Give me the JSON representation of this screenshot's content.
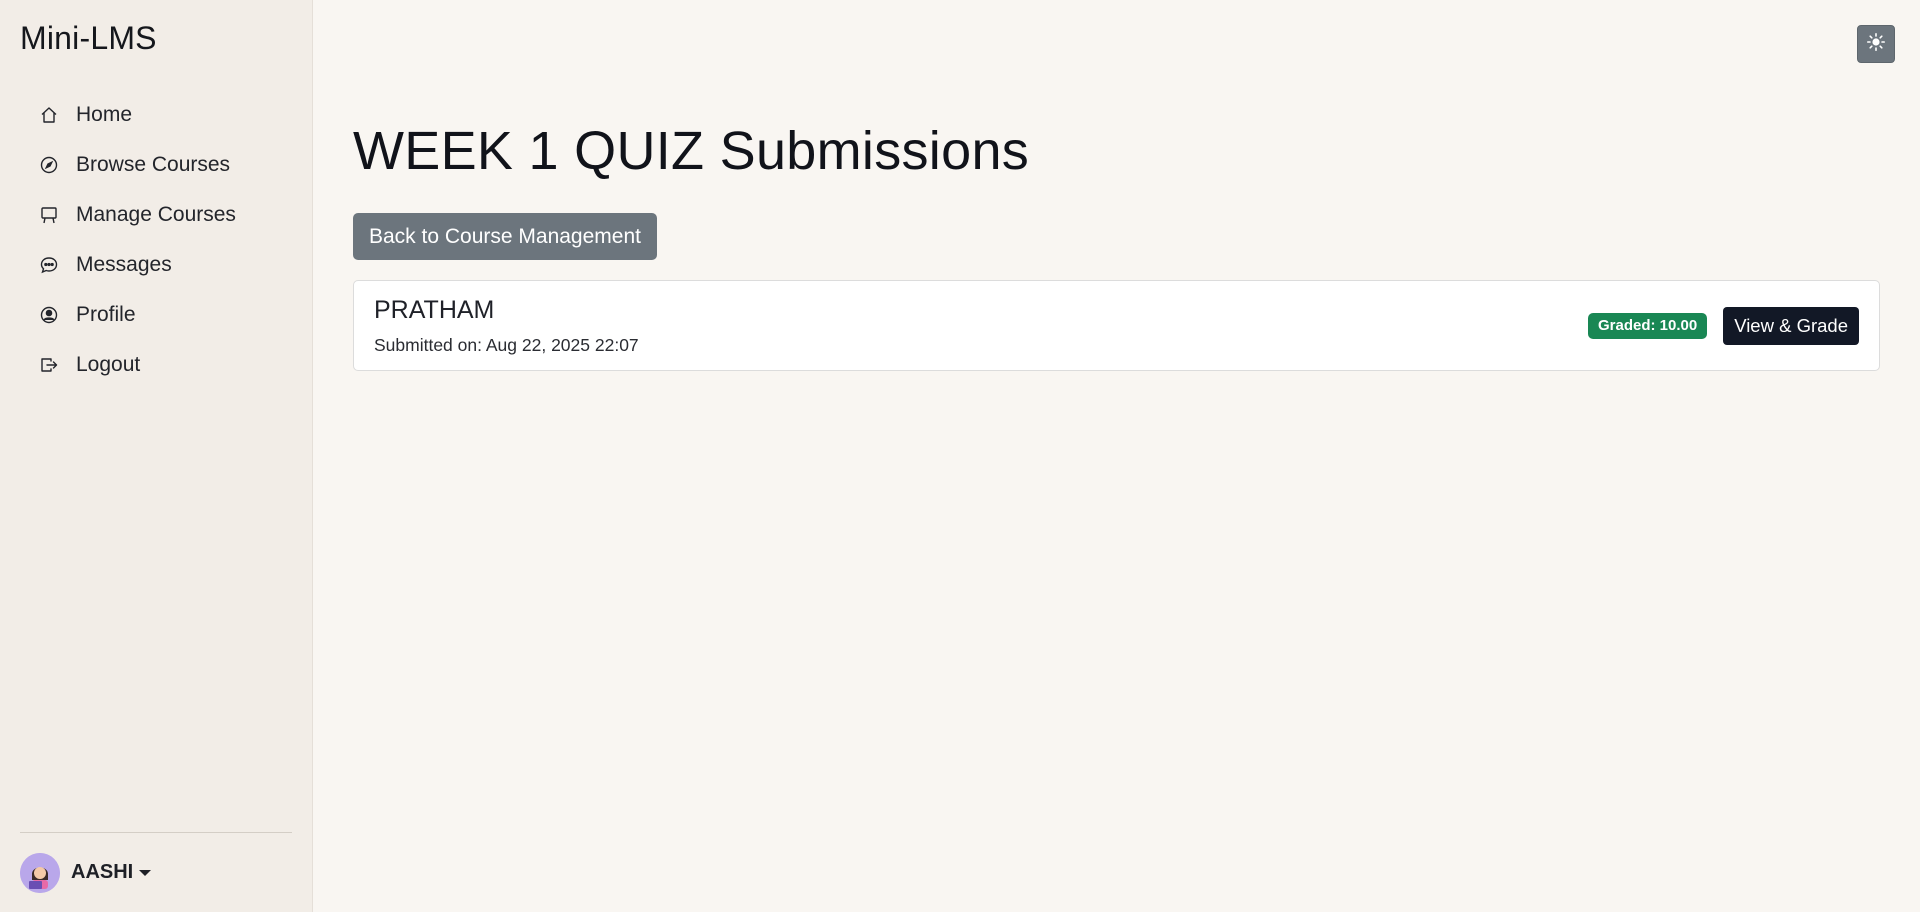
{
  "app": {
    "brand": "Mini-LMS"
  },
  "sidebar": {
    "items": [
      {
        "label": "Home",
        "icon": "home-icon"
      },
      {
        "label": "Browse Courses",
        "icon": "compass-icon"
      },
      {
        "label": "Manage Courses",
        "icon": "easel-icon"
      },
      {
        "label": "Messages",
        "icon": "chat-dots-icon"
      },
      {
        "label": "Profile",
        "icon": "person-circle-icon"
      },
      {
        "label": "Logout",
        "icon": "box-arrow-right-icon"
      }
    ],
    "user": {
      "name": "AASHI"
    }
  },
  "header": {
    "theme_toggle_icon": "sun-icon"
  },
  "main": {
    "title": "WEEK 1 QUIZ Submissions",
    "back_label": "Back to Course Management",
    "submissions": [
      {
        "student": "PRATHAM",
        "submitted": "Submitted on: Aug 22, 2025 22:07",
        "badge": "Graded: 10.00",
        "action_label": "View & Grade"
      }
    ]
  },
  "colors": {
    "sidebar_bg": "#f2ede7",
    "page_bg": "#f9f6f2",
    "secondary_button": "#6c757d",
    "success_badge": "#198754",
    "dark_button": "#121826"
  }
}
